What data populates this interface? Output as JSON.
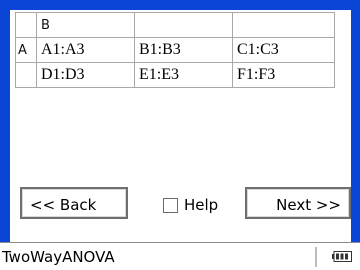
{
  "app": {
    "name": "TwoWayANOVA"
  },
  "table": {
    "column_header": "B",
    "row_header": "A",
    "rows": [
      [
        "A1:A3",
        "B1:B3",
        "C1:C3"
      ],
      [
        "D1:D3",
        "E1:E3",
        "F1:F3"
      ]
    ]
  },
  "footer": {
    "back_label": "<< Back",
    "help_label": "Help",
    "help_checked": false,
    "next_label": "Next >>"
  },
  "icons": {
    "status": "battery-icon"
  },
  "colors": {
    "frame": "#0a45d6",
    "button_border": "#6f6f6f",
    "grid_line": "#a8a8a8"
  }
}
